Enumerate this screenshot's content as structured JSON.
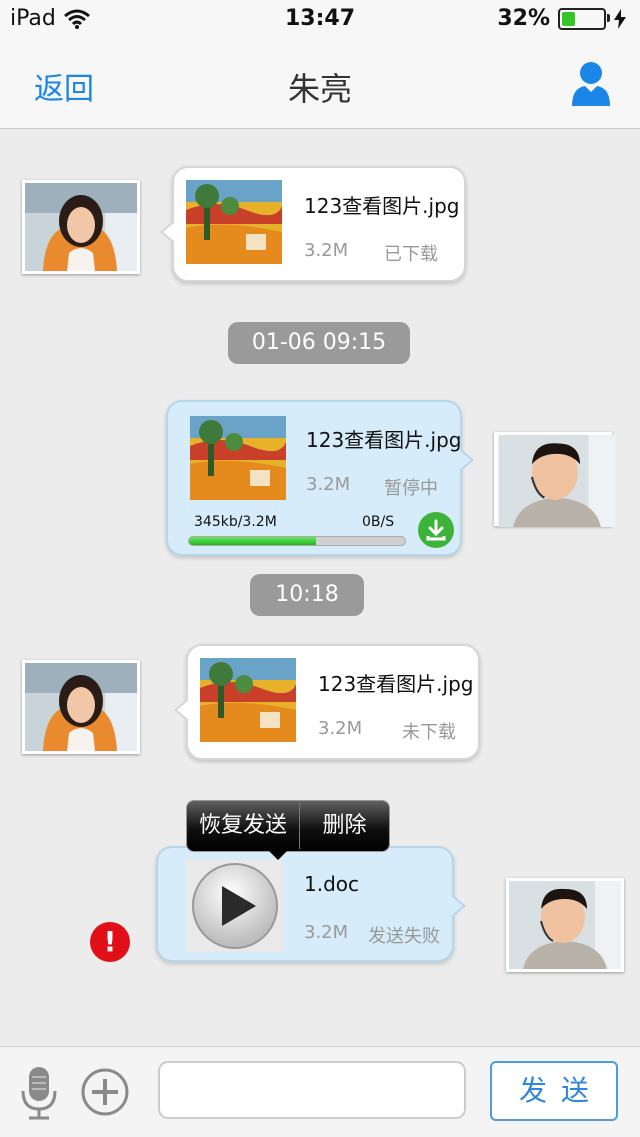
{
  "status_bar": {
    "carrier": "iPad",
    "time": "13:47",
    "battery_percent": "32%",
    "battery_level": 0.32
  },
  "nav": {
    "back_label": "返回",
    "title": "朱亮"
  },
  "messages": [
    {
      "side": "left",
      "file_name": "123查看图片.jpg",
      "size": "3.2M",
      "status": "已下载"
    },
    {
      "time": "01-06  09:15"
    },
    {
      "side": "right",
      "file_name": "123查看图片.jpg",
      "size": "3.2M",
      "status": "暂停中",
      "progress_text": "345kb/3.2M",
      "speed": "0B/S",
      "progress_fraction": 0.59
    },
    {
      "time": "10:18"
    },
    {
      "side": "left",
      "file_name": "123查看图片.jpg",
      "size": "3.2M",
      "status": "未下载"
    },
    {
      "side": "right",
      "file_name": "1.doc",
      "size": "3.2M",
      "status": "发送失败"
    }
  ],
  "context_menu": {
    "resend_label": "恢复发送",
    "delete_label": "删除"
  },
  "error_badge": "!",
  "input_bar": {
    "text_value": "",
    "send_label": "发送"
  },
  "colors": {
    "accent": "#1a86e8",
    "bubble_blue": "#d6ecfa",
    "error": "#e10f17",
    "progress": "#1fb81a"
  }
}
